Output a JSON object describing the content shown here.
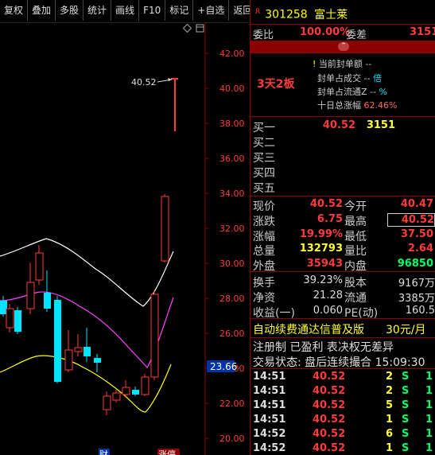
{
  "toolbar": {
    "buttons": [
      "复权",
      "叠加",
      "多股",
      "统计",
      "画线",
      "F10",
      "标记",
      "+自选",
      "返回"
    ]
  },
  "chart": {
    "y_axis_labels": [
      "42.00",
      "40.00",
      "38.00",
      "36.00",
      "34.00",
      "32.00",
      "30.00",
      "28.00",
      "26.00",
      "24.00",
      "22.00",
      "20.00"
    ],
    "current_price_tag": "23.66",
    "annotation_high": "40.52",
    "bottom_markers": [
      "财",
      "涨停"
    ]
  },
  "stock": {
    "r_badge": "R",
    "code": "301258",
    "name": "富士莱"
  },
  "weibi": {
    "label1": "委比",
    "value1": "100.00%",
    "label2": "委差",
    "value2": "3151"
  },
  "seal": {
    "board_tag": "3天2板",
    "l1": "当前封单额 --",
    "l2_label": "封单占成交 -- ",
    "l2_val": "倍",
    "l3_label": "封单占流通Z -- ",
    "l3_val": "%",
    "l4_label": "十日总涨幅 ",
    "l4_val": "62.46%"
  },
  "bids": [
    {
      "label": "买一",
      "price": "40.52",
      "vol": "3151"
    },
    {
      "label": "买二",
      "price": "",
      "vol": ""
    },
    {
      "label": "买三",
      "price": "",
      "vol": ""
    },
    {
      "label": "买四",
      "price": "",
      "vol": ""
    },
    {
      "label": "买五",
      "price": "",
      "vol": ""
    }
  ],
  "quote": [
    {
      "l1": "现价",
      "v1": "40.52",
      "l2": "今开",
      "v2": "40.47"
    },
    {
      "l1": "涨跌",
      "v1": "6.75",
      "l2": "最高",
      "v2": "40.52"
    },
    {
      "l1": "涨幅",
      "v1": "19.99%",
      "l2": "最低",
      "v2": "37.50"
    },
    {
      "l1": "总量",
      "v1": "132793",
      "l2": "量比",
      "v2": "2.64"
    },
    {
      "l1": "外盘",
      "v1": "35943",
      "l2": "内盘",
      "v2": "96850"
    }
  ],
  "fund": [
    {
      "l1": "换手",
      "v1": "39.23%",
      "l2": "股本",
      "v2": "9167万"
    },
    {
      "l1": "净资",
      "v1": "21.28",
      "l2": "流通",
      "v2": "3385万"
    },
    {
      "l1": "收益(一)",
      "v1": "0.060",
      "l2": "PE(动)",
      "v2": "160.5"
    }
  ],
  "ad": {
    "text": "自动续费通达信普及版",
    "price": "30元/月"
  },
  "status": {
    "reg": "注册制 已盈利 表决权无差异",
    "trade": "交易状态: 盘后连续撮合 15:09:30"
  },
  "ticks": [
    {
      "time": "14:51",
      "price": "40.52",
      "vol": "2",
      "side": "S",
      "n": "1"
    },
    {
      "time": "14:51",
      "price": "40.52",
      "vol": "2",
      "side": "S",
      "n": "1"
    },
    {
      "time": "14:51",
      "price": "40.52",
      "vol": "5",
      "side": "S",
      "n": "1"
    },
    {
      "time": "14:51",
      "price": "40.52",
      "vol": "1",
      "side": "S",
      "n": "1"
    },
    {
      "time": "14:52",
      "price": "40.52",
      "vol": "6",
      "side": "S",
      "n": "1"
    },
    {
      "time": "14:52",
      "price": "40.52",
      "vol": "1",
      "side": "S",
      "n": "1"
    }
  ]
}
